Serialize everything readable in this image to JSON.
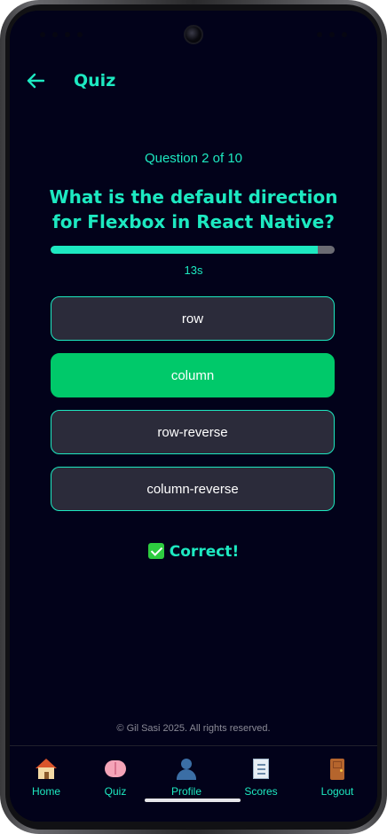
{
  "header": {
    "title": "Quiz"
  },
  "quiz": {
    "counter": "Question 2 of 10",
    "question": "What is the default direction for Flexbox in React Native?",
    "progress_fraction": 0.94,
    "timer": "13s",
    "options": [
      {
        "label": "row",
        "state": "default"
      },
      {
        "label": "column",
        "state": "correct"
      },
      {
        "label": "row-reverse",
        "state": "default"
      },
      {
        "label": "column-reverse",
        "state": "default"
      }
    ],
    "feedback": "Correct!"
  },
  "footer": {
    "copyright": "© Gil Sasi 2025. All rights reserved."
  },
  "tabs": [
    {
      "label": "Home",
      "icon": "home-icon"
    },
    {
      "label": "Quiz",
      "icon": "brain-icon"
    },
    {
      "label": "Profile",
      "icon": "profile-icon"
    },
    {
      "label": "Scores",
      "icon": "scores-icon"
    },
    {
      "label": "Logout",
      "icon": "logout-door-icon"
    }
  ],
  "colors": {
    "accent": "#1de9c1",
    "background": "#02021a",
    "option_bg": "#2b2b3a",
    "correct": "#00c96a"
  }
}
